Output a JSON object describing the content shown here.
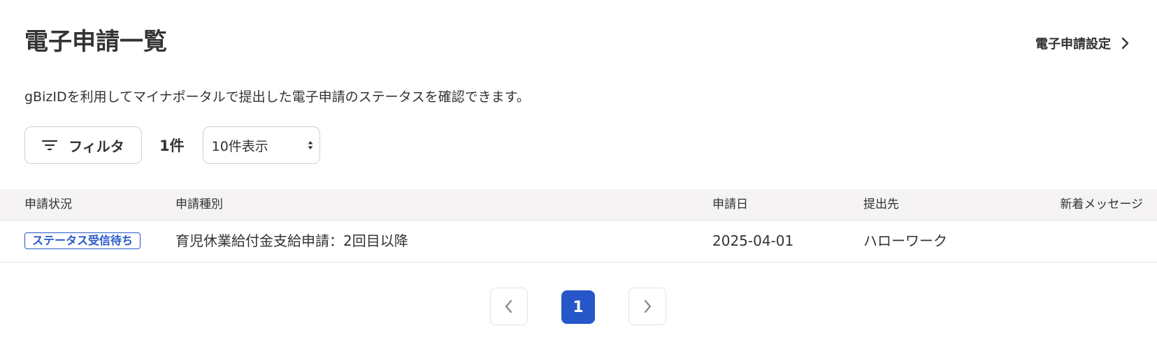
{
  "header": {
    "title": "電子申請一覧",
    "settings_link_label": "電子申請設定"
  },
  "description": "gBizIDを利用してマイナポータルで提出した電子申請のステータスを確認できます。",
  "toolbar": {
    "filter_label": "フィルタ",
    "count": "1件",
    "page_size_selected": "10件表示"
  },
  "table": {
    "columns": [
      "申請状況",
      "申請種別",
      "申請日",
      "提出先",
      "新着メッセージ"
    ],
    "rows": [
      {
        "status": "ステータス受信待ち",
        "type": "育児休業給付金支給申請：2回目以降",
        "date": "2025-04-01",
        "destination": "ハローワーク",
        "new_message": ""
      }
    ]
  },
  "pagination": {
    "current_page": "1"
  },
  "colors": {
    "accent": "#2657c9",
    "text": "#333333",
    "table_header_bg": "#f5f3f4",
    "border": "#d0d0d0"
  },
  "icons": {
    "settings_link": "chevron-right-icon",
    "filter": "filter-icon",
    "select": "select-arrows-icon",
    "prev": "chevron-left-icon",
    "next": "chevron-right-icon"
  }
}
